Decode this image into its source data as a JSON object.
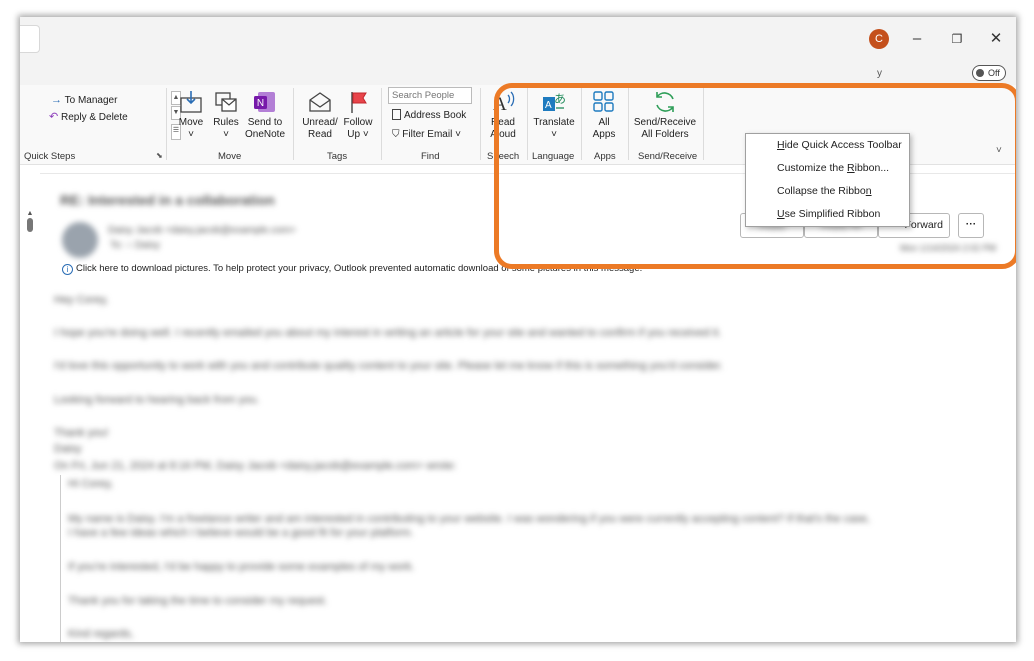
{
  "titlebar": {
    "avatar_initial": "C",
    "minimize": "–",
    "restore": "❐",
    "close": "✕"
  },
  "subbar": {
    "toggle_label": "Off",
    "dot": "y"
  },
  "ribbon": {
    "quick_steps": {
      "items": [
        "To Manager",
        "Reply & Delete"
      ],
      "group_label": "Quick Steps"
    },
    "move": {
      "buttons": [
        {
          "label1": "Move",
          "label2": "˅"
        },
        {
          "label1": "Rules",
          "label2": "˅"
        },
        {
          "label1": "Send to",
          "label2": "OneNote"
        }
      ],
      "group_label": "Move"
    },
    "tags": {
      "buttons": [
        {
          "label1": "Unread/",
          "label2": "Read"
        },
        {
          "label1": "Follow",
          "label2": "Up ˅"
        }
      ],
      "group_label": "Tags"
    },
    "find": {
      "search_placeholder": "Search People",
      "address_book": "Address Book",
      "filter_email": "Filter Email ˅",
      "group_label": "Find"
    },
    "speech": {
      "label1": "Read",
      "label2": "Aloud",
      "group_label": "Speech"
    },
    "language": {
      "label1": "Translate",
      "label2": "˅",
      "group_label": "Language"
    },
    "apps": {
      "label1": "All",
      "label2": "Apps",
      "group_label": "Apps"
    },
    "send_receive": {
      "label1": "Send/Receive",
      "label2": "All Folders",
      "group_label": "Send/Receive"
    },
    "collapse_arrow": "˅"
  },
  "context_menu": {
    "items": [
      {
        "pre": "",
        "ul": "H",
        "post": "ide Quick Access Toolbar"
      },
      {
        "pre": "Customize the ",
        "ul": "R",
        "post": "ibbon..."
      },
      {
        "pre": "Collapse the Ribbo",
        "ul": "n",
        "post": ""
      },
      {
        "pre": "",
        "ul": "U",
        "post": "se Simplified Ribbon"
      }
    ]
  },
  "message": {
    "subject": "RE: Interested in a collaboration",
    "sender": "Daisy Jacob <daisy.jacob@example.com>",
    "to": "To: ○ Daisy",
    "reply_label": "Reply",
    "reply_all_label": "Reply All",
    "forward_label": "Forward",
    "more_label": "···",
    "date": "Mon 1/14/2024 2:02 PM",
    "info_text": "Click here to download pictures. To help protect your privacy, Outlook prevented automatic download of some pictures in this message.",
    "body": [
      "Hey Corey,",
      "I hope you're doing well. I recently emailed you about my interest in writing an article for your site and wanted to confirm if you received it.",
      "I'd love this opportunity to work with you and contribute quality content to your site. Please let me know if this is something you'd consider.",
      "Looking forward to hearing back from you.",
      "Thank you!",
      "Daisy",
      "On Fri, Jun 21, 2024 at 8:16 PM, Daisy Jacob <daisy.jacob@example.com> wrote:",
      "Hi Corey,",
      "My name is Daisy. I'm a freelance writer and am interested in contributing to your website. I was wondering if you were currently accepting content? If that's the case,",
      "I have a few ideas which I believe would be a good fit for your platform.",
      "If you're interested, I'd be happy to provide some examples of my work.",
      "Thank you for taking the time to consider my request.",
      "Kind regards,"
    ]
  },
  "colors": {
    "highlight": "#ec7a26",
    "avatar": "#c4501c",
    "onenote": "#7719aa",
    "link": "#2a6db5"
  }
}
